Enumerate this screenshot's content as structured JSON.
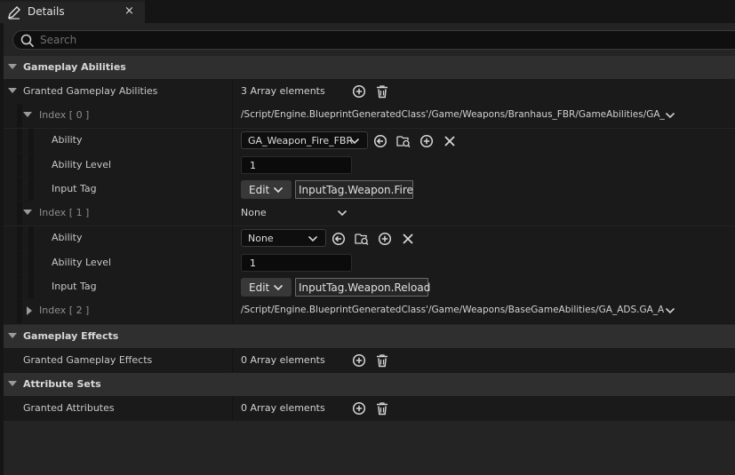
{
  "tab": {
    "title": "Details",
    "close": "×"
  },
  "search": {
    "placeholder": "Search",
    "value": ""
  },
  "categories": {
    "gameplay_abilities": "Gameplay Abilities",
    "gameplay_effects": "Gameplay Effects",
    "attribute_sets": "Attribute Sets"
  },
  "granted_abilities": {
    "label": "Granted Gameplay Abilities",
    "count": "3 Array elements",
    "elements": [
      {
        "index_label": "Index [ 0 ]",
        "value": "/Script/Engine.BlueprintGeneratedClass'/Game/Weapons/Branhaus_FBR/GameAbilities/GA_",
        "ability_label": "Ability",
        "ability_value": "GA_Weapon_Fire_FBR",
        "level_label": "Ability Level",
        "level_value": "1",
        "tag_label": "Input Tag",
        "edit_label": "Edit",
        "tag_value": "InputTag.Weapon.Fire"
      },
      {
        "index_label": "Index [ 1 ]",
        "value": "None",
        "ability_label": "Ability",
        "ability_value": "None",
        "level_label": "Ability Level",
        "level_value": "1",
        "tag_label": "Input Tag",
        "edit_label": "Edit",
        "tag_value": "InputTag.Weapon.Reload"
      },
      {
        "index_label": "Index [ 2 ]",
        "value": "/Script/Engine.BlueprintGeneratedClass'/Game/Weapons/BaseGameAbilities/GA_ADS.GA_A"
      }
    ]
  },
  "granted_effects": {
    "label": "Granted Gameplay Effects",
    "count": "0 Array elements"
  },
  "granted_attributes": {
    "label": "Granted Attributes",
    "count": "0 Array elements"
  }
}
